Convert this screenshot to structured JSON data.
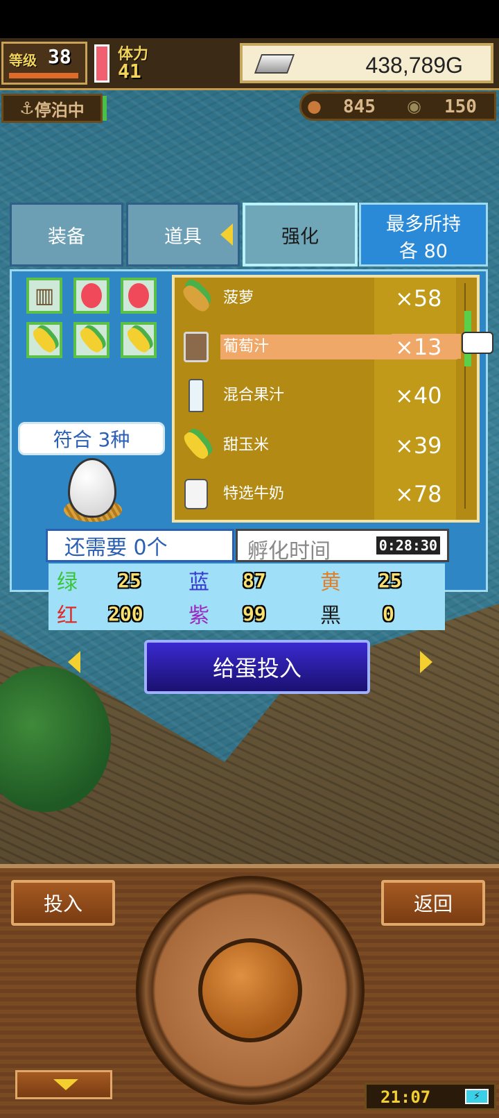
{
  "status": {
    "level_label": "等级",
    "level_value": "38",
    "stamina_label": "体力",
    "stamina_value": "41",
    "gold": "438,789G",
    "harbor_status": "停泊中",
    "resource1": "845",
    "resource2": "150"
  },
  "tabs": [
    {
      "label": "装备"
    },
    {
      "label": "道具"
    },
    {
      "label": "强化"
    }
  ],
  "max_hold": {
    "line1": "最多所持",
    "line2": "各 80"
  },
  "match_text": "符合 3种",
  "items": [
    {
      "name": "菠萝",
      "qty": "×58",
      "icon": "pineapple-icon"
    },
    {
      "name": "葡萄汁",
      "qty": "×13",
      "icon": "mug-icon",
      "selected": true
    },
    {
      "name": "混合果汁",
      "qty": "×40",
      "icon": "bottle-icon"
    },
    {
      "name": "甜玉米",
      "qty": "×39",
      "icon": "corn-icon"
    },
    {
      "name": "特选牛奶",
      "qty": "×78",
      "icon": "milk-icon"
    }
  ],
  "egg_slots": [
    "mug-icon",
    "red-egg-icon",
    "red-egg-icon",
    "corn-icon",
    "corn-icon",
    "corn-icon"
  ],
  "needed": "还需要 0个",
  "hatch_label": "孵化时间",
  "hatch_time": "0:28:30",
  "stats": [
    {
      "label": "绿",
      "value": "25",
      "color": "#3ac43a"
    },
    {
      "label": "蓝",
      "value": "87",
      "color": "#3a3ad0"
    },
    {
      "label": "黄",
      "value": "25",
      "color": "#e0802a"
    },
    {
      "label": "红",
      "value": "200",
      "color": "#e02a2a"
    },
    {
      "label": "紫",
      "value": "99",
      "color": "#9a2ac0"
    },
    {
      "label": "黑",
      "value": "0",
      "color": "#1a1a1a"
    }
  ],
  "feed_button": "给蛋投入",
  "left_button": "投入",
  "right_button": "返回",
  "clock": "21:07"
}
